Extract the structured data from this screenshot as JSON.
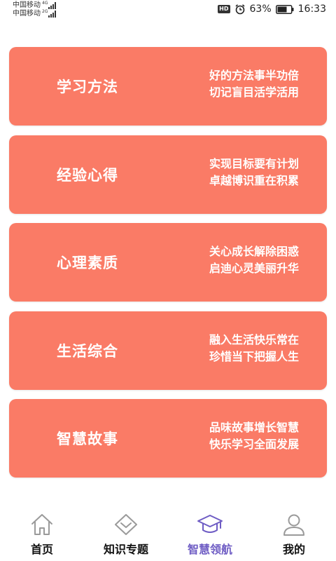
{
  "status_bar": {
    "carrier_1": "中国移动",
    "network_1": "4G",
    "carrier_2": "中国移动",
    "network_2": "2G",
    "hd": "HD",
    "battery": "63%",
    "time": "16:33"
  },
  "cards": [
    {
      "title": "学习方法",
      "line1": "好的方法事半功倍",
      "line2": "切记盲目活学活用"
    },
    {
      "title": "经验心得",
      "line1": "实现目标要有计划",
      "line2": "卓越博识重在积累"
    },
    {
      "title": "心理素质",
      "line1": "关心成长解除困惑",
      "line2": "启迪心灵美丽升华"
    },
    {
      "title": "生活综合",
      "line1": "融入生活快乐常在",
      "line2": "珍惜当下把握人生"
    },
    {
      "title": "智慧故事",
      "line1": "品味故事增长智慧",
      "line2": "快乐学习全面发展"
    }
  ],
  "nav": [
    {
      "label": "首页",
      "icon": "home-icon"
    },
    {
      "label": "知识专题",
      "icon": "diamond-icon"
    },
    {
      "label": "智慧领航",
      "icon": "graduation-cap-icon",
      "active": true
    },
    {
      "label": "我的",
      "icon": "user-icon"
    }
  ],
  "colors": {
    "card": "#fa7b66",
    "active_nav": "#6e5cc4",
    "inactive_icon": "#9a9a9a"
  }
}
